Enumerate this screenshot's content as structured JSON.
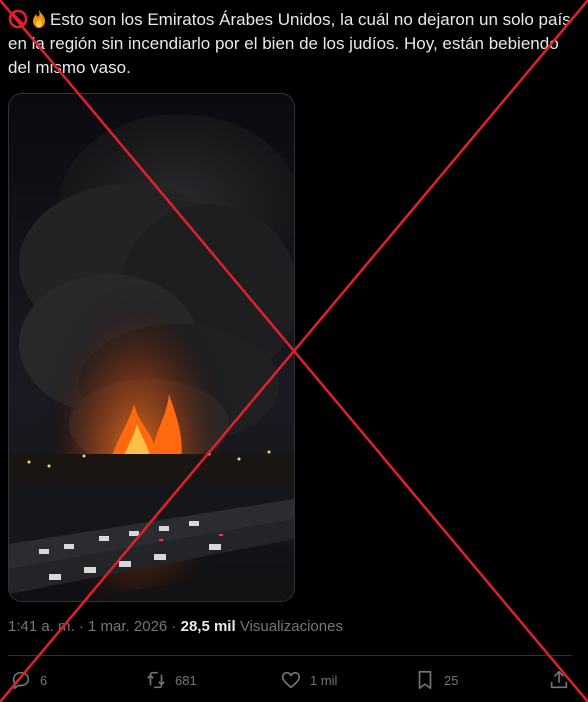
{
  "tweet": {
    "text": "Esto son los Emiratos Árabes Unidos, la cuál no dejaron un solo país en la región sin incendiarlo por el bien de los judíos. Hoy, están bebiendo del mismo vaso.",
    "emojis": [
      "prohibited-icon",
      "fire-icon"
    ]
  },
  "meta": {
    "time": "1:41 a. m.",
    "separator": " · ",
    "date": "1 mar. 2026",
    "views_count": "28,5 mil",
    "views_label": "Visualizaciones"
  },
  "actions": {
    "replies": "6",
    "reposts": "681",
    "likes": "1 mil",
    "bookmarks": "25"
  },
  "colors": {
    "background": "#000000",
    "text": "#e7e9ea",
    "muted": "#71767b",
    "cross": "#e0202a"
  }
}
